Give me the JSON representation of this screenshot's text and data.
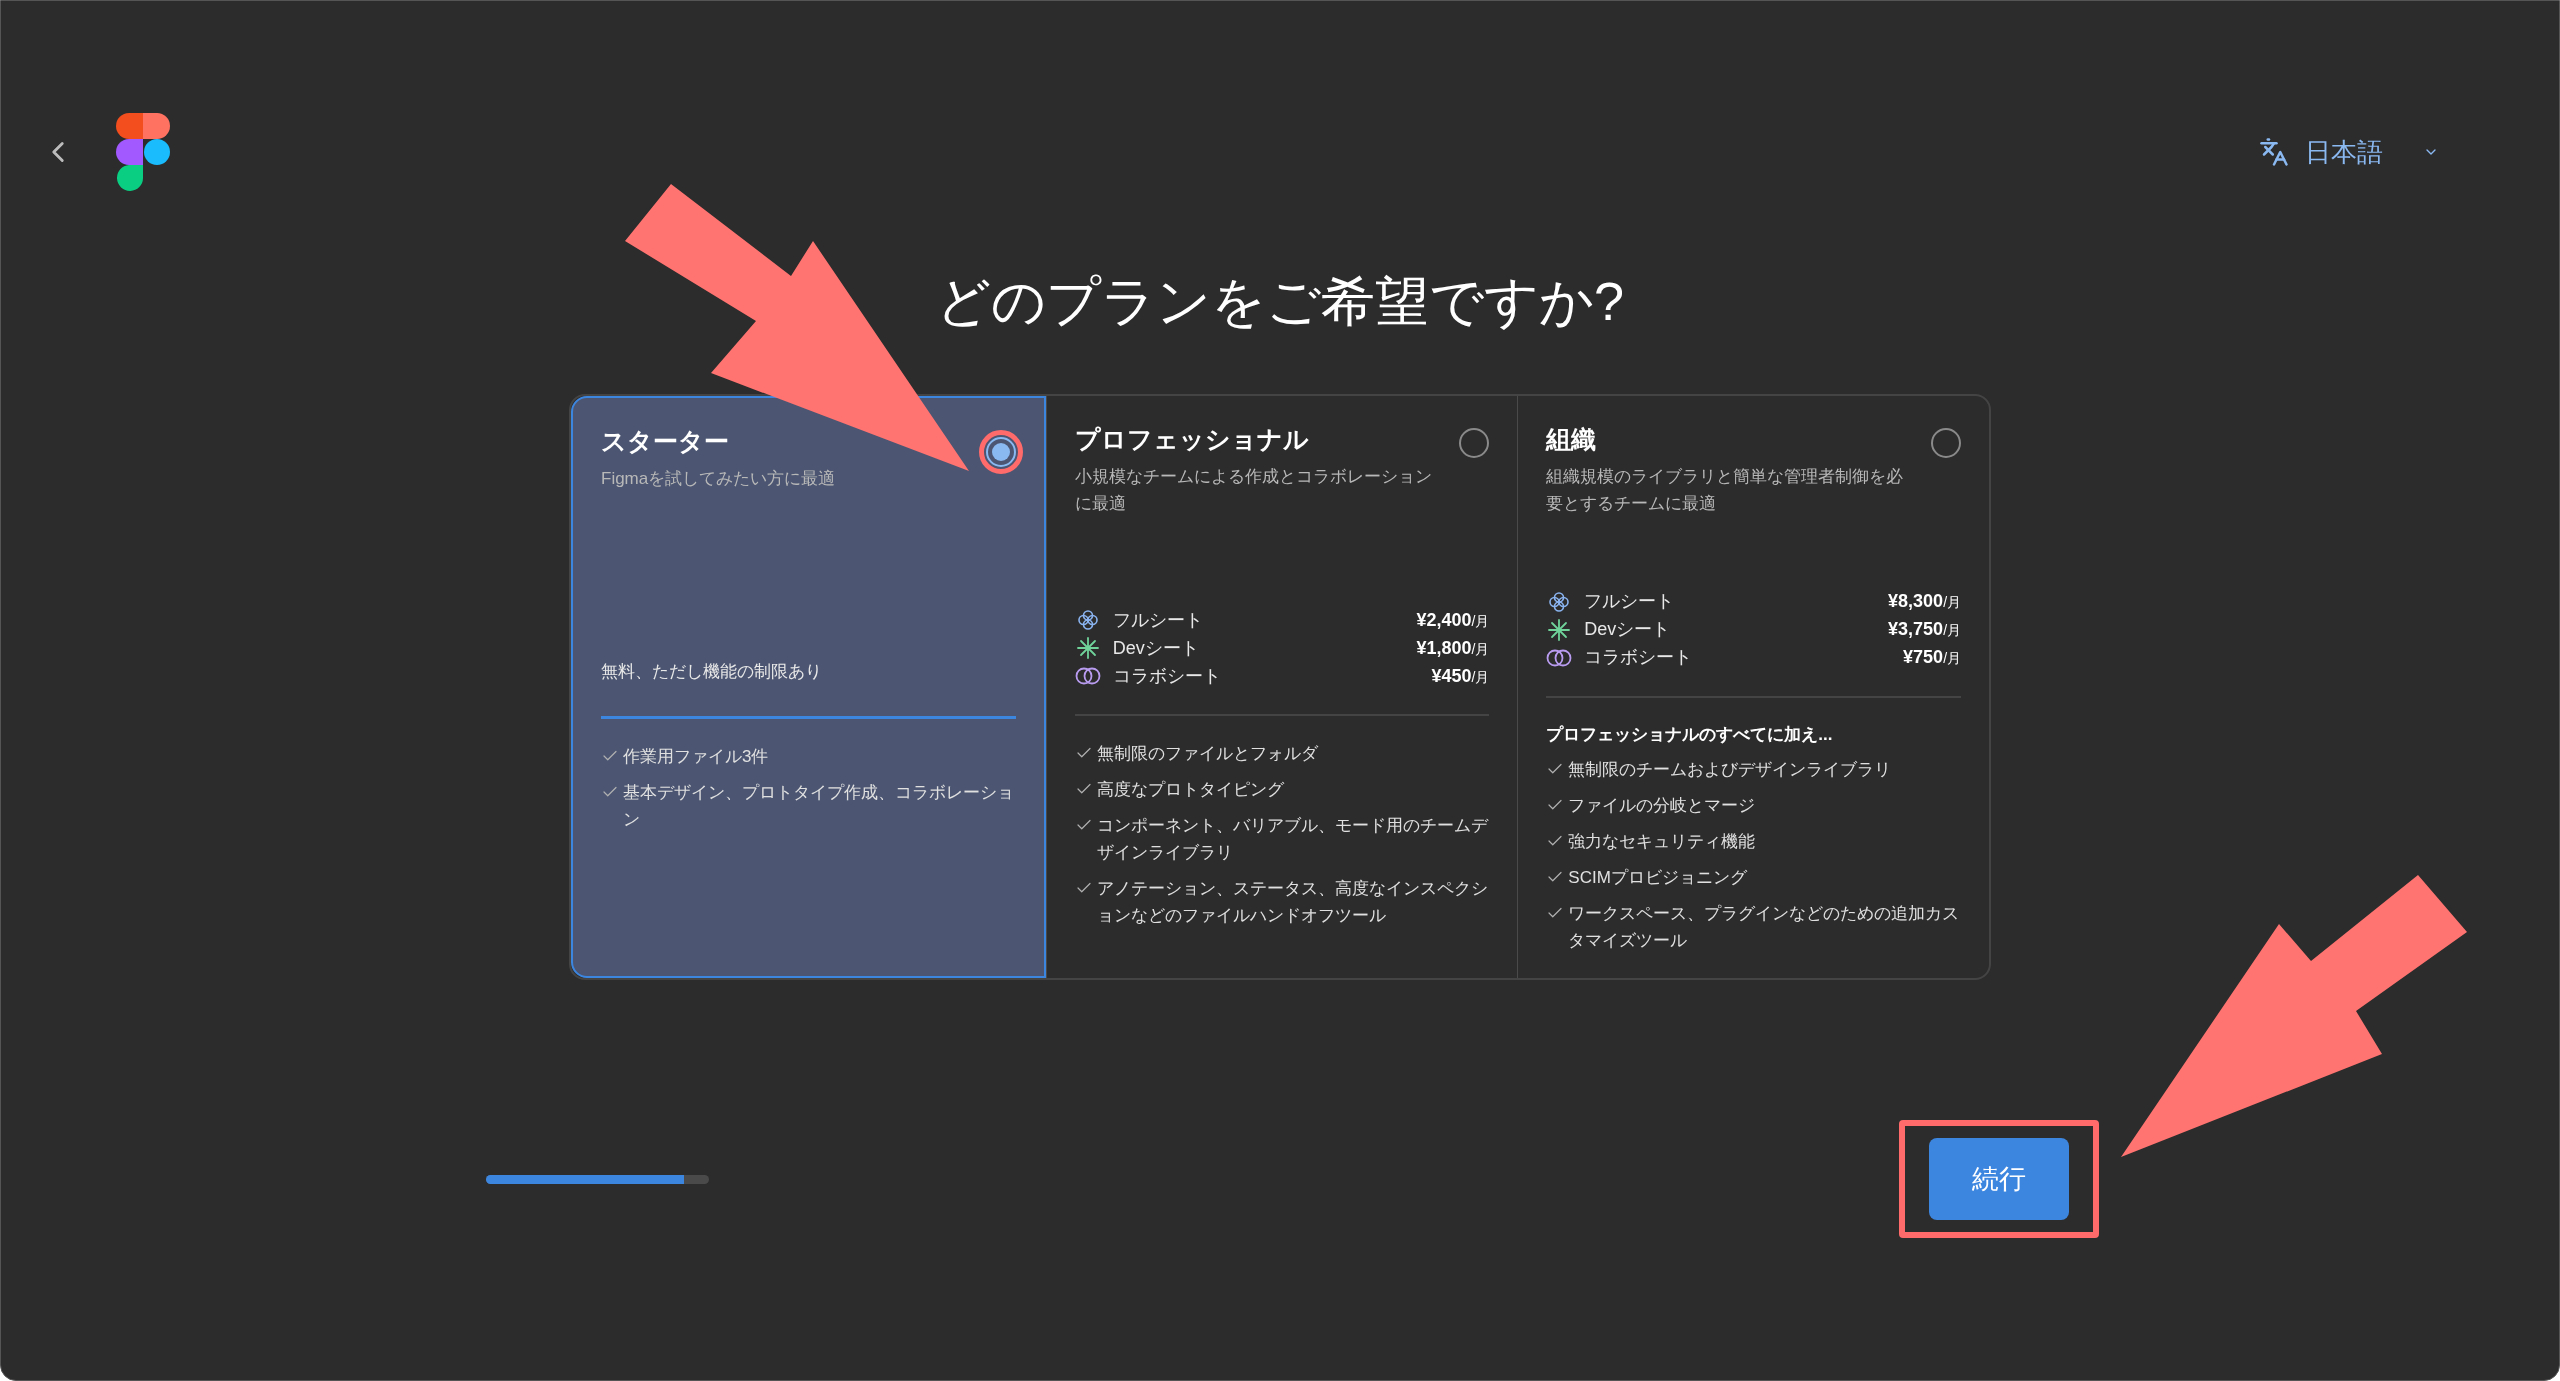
{
  "header": {
    "language": "日本語"
  },
  "title": "どのプランをご希望ですか?",
  "plans": [
    {
      "kind": "free",
      "name": "スターター",
      "description": "Figmaを試してみたい方に最適",
      "selected": true,
      "note": "無料、ただし機能の制限あり",
      "features": [
        "作業用ファイル3件",
        "基本デザイン、プロトタイプ作成、コラボレーション"
      ]
    },
    {
      "kind": "paid",
      "name": "プロフェッショナル",
      "description": "小規模なチームによる作成とコラボレーションに最適",
      "selected": false,
      "seats": [
        {
          "kind": "full",
          "label": "フルシート",
          "price": "¥2,400",
          "unit": "/月"
        },
        {
          "kind": "dev",
          "label": "Devシート",
          "price": "¥1,800",
          "unit": "/月"
        },
        {
          "kind": "collab",
          "label": "コラボシート",
          "price": "¥450",
          "unit": "/月"
        }
      ],
      "features": [
        "無制限のファイルとフォルダ",
        "高度なプロトタイピング",
        "コンポーネント、バリアブル、モード用のチームデザインライブラリ",
        "アノテーション、ステータス、高度なインスペクションなどのファイルハンドオフツール"
      ]
    },
    {
      "kind": "paid",
      "name": "組織",
      "description": "組織規模のライブラリと簡単な管理者制御を必要とするチームに最適",
      "selected": false,
      "seats": [
        {
          "kind": "full",
          "label": "フルシート",
          "price": "¥8,300",
          "unit": "/月"
        },
        {
          "kind": "dev",
          "label": "Devシート",
          "price": "¥3,750",
          "unit": "/月"
        },
        {
          "kind": "collab",
          "label": "コラボシート",
          "price": "¥750",
          "unit": "/月"
        }
      ],
      "features_heading": "プロフェッショナルのすべてに加え...",
      "features": [
        "無制限のチームおよびデザインライブラリ",
        "ファイルの分岐とマージ",
        "強力なセキュリティ機能",
        "SCIMプロビジョニング",
        "ワークスペース、プラグインなどのための追加カスタマイズツール"
      ]
    }
  ],
  "progress": {
    "level": 0.89
  },
  "continue_button": "続行"
}
